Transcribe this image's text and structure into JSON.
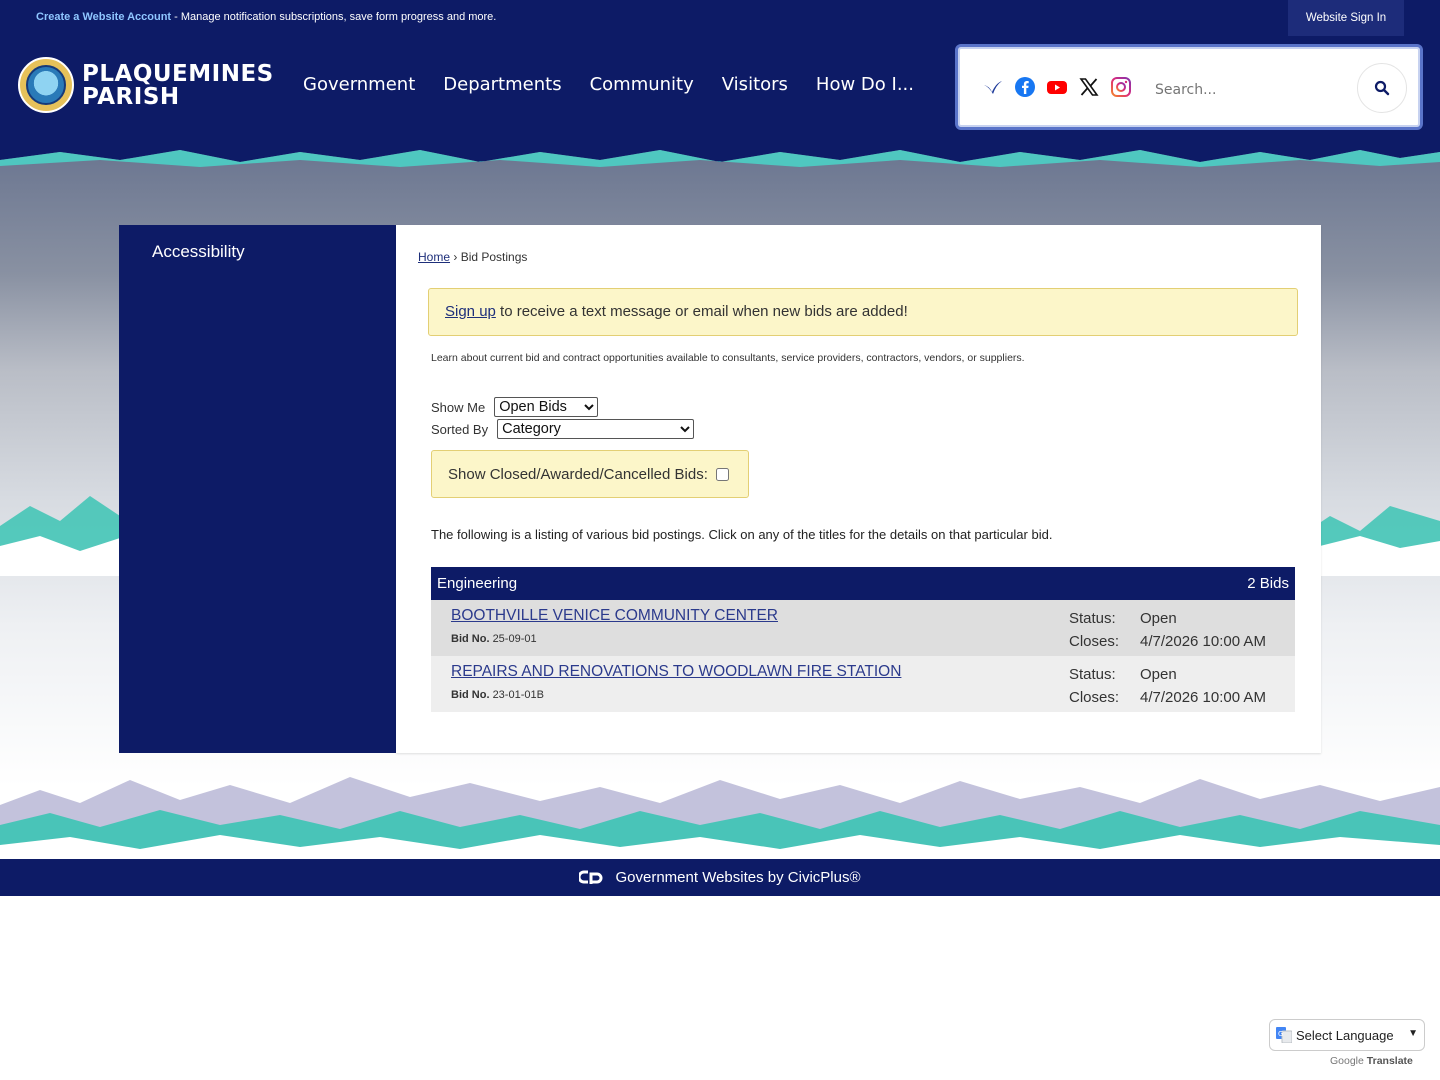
{
  "topbar": {
    "create_link": "Create a Website Account",
    "message": " - Manage notification subscriptions, save form progress and more.",
    "signin_label": "Website Sign In"
  },
  "header": {
    "logo_line1": "PLAQUEMINES",
    "logo_line2": "PARISH",
    "nav": [
      "Government",
      "Departments",
      "Community",
      "Visitors",
      "How Do I..."
    ],
    "search_placeholder": "Search..."
  },
  "social_icons": [
    "bluesky-icon",
    "facebook-icon",
    "youtube-icon",
    "x-icon",
    "instagram-icon"
  ],
  "sidebar": {
    "items": [
      "Accessibility"
    ]
  },
  "breadcrumb": {
    "home": "Home",
    "separator": " › ",
    "current": "Bid Postings"
  },
  "alert": {
    "link": "Sign up",
    "text": " to receive a text message or email when new bids are added!"
  },
  "intro": "Learn about current bid and contract opportunities available to consultants, service providers, contractors, vendors, or suppliers.",
  "filters": {
    "show_label": "Show Me",
    "show_value": "Open Bids",
    "sort_label": "Sorted By",
    "sort_value": "Category"
  },
  "closed_toggle": {
    "label": "Show Closed/Awarded/Cancelled Bids:"
  },
  "listing_note": "The following is a listing of various bid postings. Click on any of the titles for the details on that particular bid.",
  "bids": {
    "category": "Engineering",
    "count": "2 Bids",
    "bid_no_label": "Bid No.",
    "status_label": "Status:",
    "closes_label": "Closes:",
    "rows": [
      {
        "title": "BOOTHVILLE VENICE COMMUNITY CENTER",
        "bid_no": "25-09-01",
        "status": "Open",
        "closes": "4/7/2026 10:00 AM"
      },
      {
        "title": "REPAIRS AND RENOVATIONS TO WOODLAWN FIRE STATION",
        "bid_no": "23-01-01B",
        "status": "Open",
        "closes": "4/7/2026 10:00 AM"
      }
    ]
  },
  "footer": {
    "text": "Government Websites by CivicPlus®"
  },
  "translate": {
    "select_label": "Select Language",
    "powered_prefix": "Google",
    "powered_suffix": "Translate"
  },
  "colors": {
    "navy": "#0d1b66",
    "alert_bg": "#fcf6c9",
    "link": "#2b3a8c",
    "teal": "#3cc4b4"
  }
}
